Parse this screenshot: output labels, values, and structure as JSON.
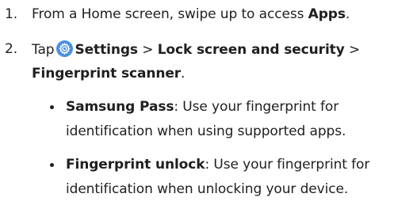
{
  "steps": [
    {
      "number": "1.",
      "parts": {
        "text1": "From a Home screen, swipe up to access ",
        "apps": "Apps",
        "end": "."
      }
    },
    {
      "number": "2.",
      "parts": {
        "tap": "Tap",
        "settings": "Settings",
        "sep1": " > ",
        "lock": "Lock screen and security",
        "sep2": " >",
        "fingerprint": "Fingerprint scanner",
        "end": "."
      }
    }
  ],
  "bullets": [
    {
      "term": "Samsung Pass",
      "line1": ": Use your fingerprint for",
      "line2": "identification when using supported apps."
    },
    {
      "term": "Fingerprint unlock",
      "line1": ": Use your fingerprint for",
      "line2": "identification when unlocking your device."
    }
  ],
  "colors": {
    "text": "#1f1f1f",
    "settings_icon_bg": "#4a90e2"
  },
  "icons": {
    "settings": "settings-gear-icon"
  }
}
